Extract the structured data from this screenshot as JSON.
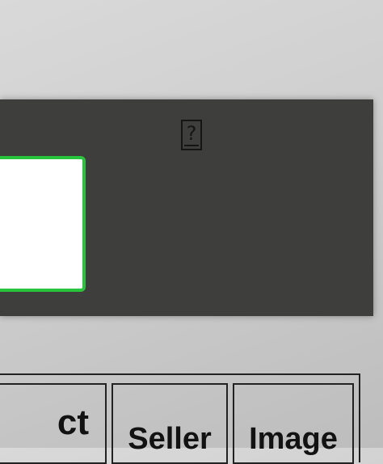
{
  "panel": {
    "help_icon": "question-mark-icon"
  },
  "table": {
    "headers": [
      "ct",
      "Seller",
      "Image"
    ]
  },
  "colors": {
    "panel_background": "#3e3f3c",
    "selection_border": "#28c43e",
    "page_background": "#d4d4d4"
  }
}
